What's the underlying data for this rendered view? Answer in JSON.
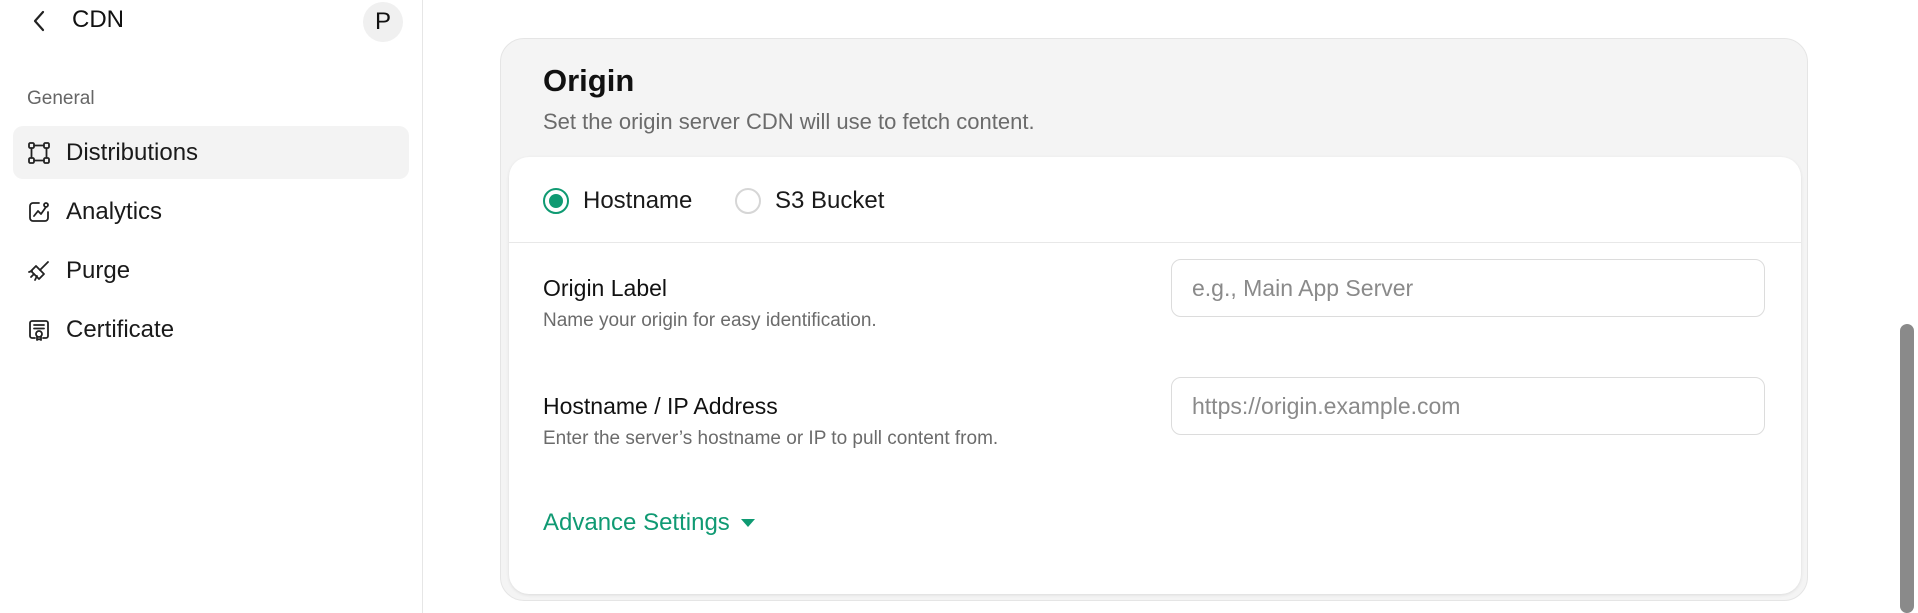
{
  "sidebar": {
    "title": "CDN",
    "avatar_initial": "P",
    "section_label": "General",
    "items": [
      {
        "label": "Distributions",
        "icon": "distributions-icon",
        "active": true
      },
      {
        "label": "Analytics",
        "icon": "analytics-icon",
        "active": false
      },
      {
        "label": "Purge",
        "icon": "purge-icon",
        "active": false
      },
      {
        "label": "Certificate",
        "icon": "certificate-icon",
        "active": false
      }
    ]
  },
  "origin": {
    "title": "Origin",
    "subtitle": "Set the origin server CDN will use to fetch content.",
    "radios": [
      {
        "label": "Hostname",
        "selected": true
      },
      {
        "label": "S3 Bucket",
        "selected": false
      }
    ],
    "fields": {
      "label": {
        "title": "Origin Label",
        "description": "Name your origin for easy identification.",
        "placeholder": "e.g., Main App Server",
        "value": ""
      },
      "hostname": {
        "title": "Hostname / IP Address",
        "description": "Enter the server’s hostname or IP to pull content from.",
        "placeholder": "https://origin.example.com",
        "value": ""
      }
    },
    "advance_settings_label": "Advance Settings"
  },
  "colors": {
    "accent": "#0f9a72",
    "active_nav_bg": "#f3f3f3",
    "card_bg": "#f4f4f4"
  }
}
